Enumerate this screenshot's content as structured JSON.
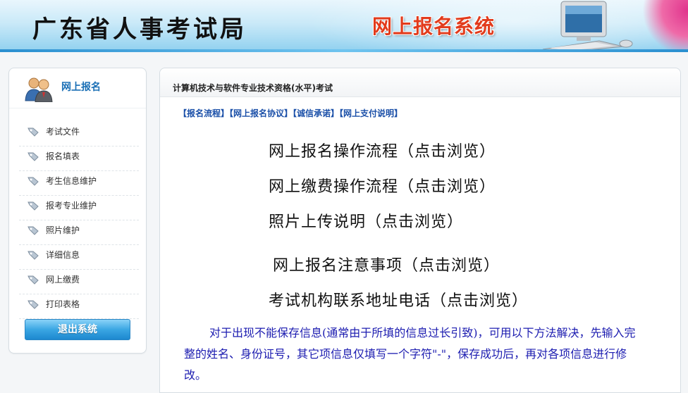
{
  "header": {
    "site_title": "广东省人事考试局",
    "system_title": "网上报名系统"
  },
  "sidebar": {
    "title": "网上报名",
    "items": [
      {
        "label": "考试文件"
      },
      {
        "label": "报名填表"
      },
      {
        "label": "考生信息维护"
      },
      {
        "label": "报考专业维护"
      },
      {
        "label": "照片维护"
      },
      {
        "label": "详细信息"
      },
      {
        "label": "网上缴费"
      },
      {
        "label": "打印表格"
      }
    ],
    "logout_label": "退出系统"
  },
  "main": {
    "title": "计算机技术与软件专业技术资格(水平)考试",
    "quick_links": [
      "【报名流程】",
      "【网上报名协议】",
      "【诚信承诺】",
      "【网上支付说明】"
    ],
    "guide_links": [
      {
        "label": "网上报名操作流程（点击浏览）"
      },
      {
        "label": "网上缴费操作流程（点击浏览）"
      },
      {
        "label": "照片上传说明（点击浏览）"
      },
      {
        "label": "网上报名注意事项（点击浏览）"
      },
      {
        "label": "考试机构联系地址电话（点击浏览）"
      }
    ],
    "notice": "对于出现不能保存信息(通常由于所填的信息过长引致)，可用以下方法解决，先输入完整的姓名、身份证号，其它项信息仅填写一个字符\"-\"，保存成功后，再对各项信息进行修改。"
  },
  "colors": {
    "accent_blue": "#1a6fb5",
    "link_blue": "#1a4fa8",
    "notice_blue": "#1c1cb0",
    "system_title_red": "#e23b1c"
  },
  "icons": {
    "sidebar_header": "users-icon",
    "menu_item": "tag-icon",
    "header_art": "computer-icon"
  }
}
